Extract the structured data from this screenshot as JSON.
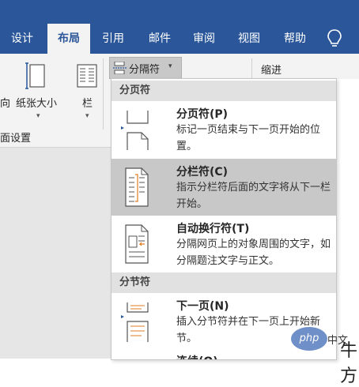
{
  "tabs": [
    "设计",
    "布局",
    "引用",
    "邮件",
    "审阅",
    "视图",
    "帮助"
  ],
  "ribbon": {
    "orientation_partial": "向",
    "paper_size": "纸张大小",
    "columns": "栏",
    "breaks_button": "分隔符",
    "indent": "缩进",
    "group_label": "面设置"
  },
  "menu": {
    "page_breaks_header": "分页符",
    "section_breaks_header": "分节符",
    "items": [
      {
        "title": "分页符(P)",
        "desc": "标记一页结束与下一页开始的位置。"
      },
      {
        "title": "分栏符(C)",
        "desc": "指示分栏符后面的文字将从下一栏开始。"
      },
      {
        "title": "自动换行符(T)",
        "desc": "分隔网页上的对象周围的文字，如分隔题注文字与正文。"
      },
      {
        "title": "下一页(N)",
        "desc": "插入分节符并在下一页上开始新节。"
      },
      {
        "title": "连续(O)"
      }
    ]
  },
  "watermark": {
    "logo": "php",
    "site": "中文",
    "char": "牛方"
  },
  "colors": {
    "ribbon_blue": "#2b579a",
    "highlight": "#c8c8c8",
    "header_gray": "#e1e1e1"
  }
}
